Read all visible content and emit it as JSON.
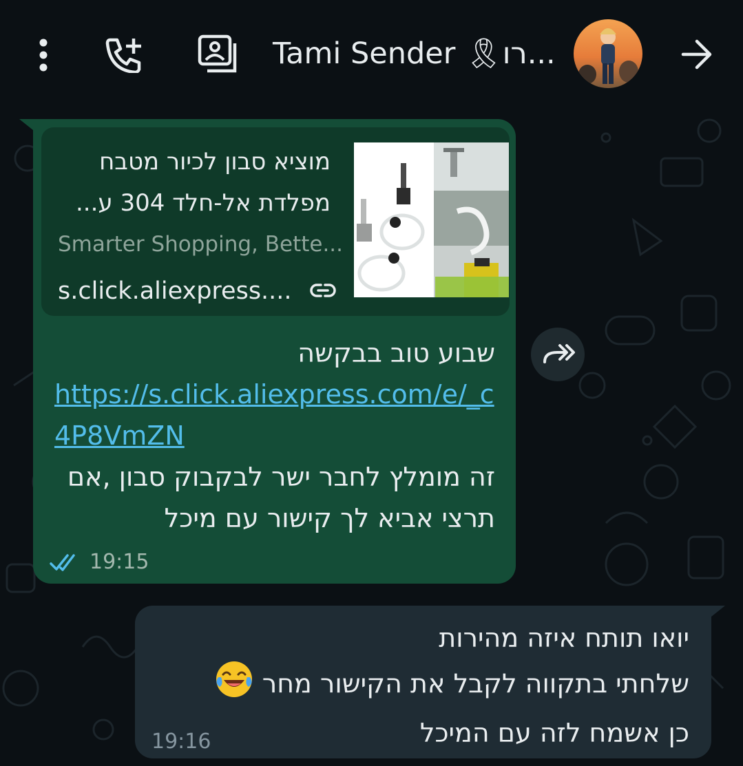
{
  "header": {
    "title": "Tami Sender 🎗רו...",
    "icons": [
      "more-vert-icon",
      "add-call-icon",
      "contact-card-icon",
      "avatar",
      "back-arrow-icon"
    ]
  },
  "messages": [
    {
      "direction": "outgoing",
      "link_preview": {
        "title": "מוציא סבון לכיור מטבח מפלדת אל-חלד 304 ע...",
        "description": "Smarter Shopping, Bette...",
        "domain": "s.click.aliexpress...."
      },
      "line1": "שבוע טוב בבקשה",
      "url": "https://s.click.aliexpress.com/e/_c4P8VmZN",
      "line2": "זה מומלץ לחבר ישר לבקבוק סבון ,אם תרצי אביא לך קישור עם מיכל",
      "time": "19:15",
      "status": "read"
    },
    {
      "direction": "incoming",
      "line1": "יואו תותח איזה מהירות",
      "line2": "שלחתי בתקווה לקבל את הקישור מחר",
      "line3": "כן אשמח לזה עם המיכל",
      "emoji": "😂",
      "time": "19:16"
    }
  ],
  "colors": {
    "background": "#0b1014",
    "outgoing_bubble": "#144d37",
    "incoming_bubble": "#1f2c34",
    "link": "#53bdeb",
    "read_ticks": "#53bdeb"
  }
}
